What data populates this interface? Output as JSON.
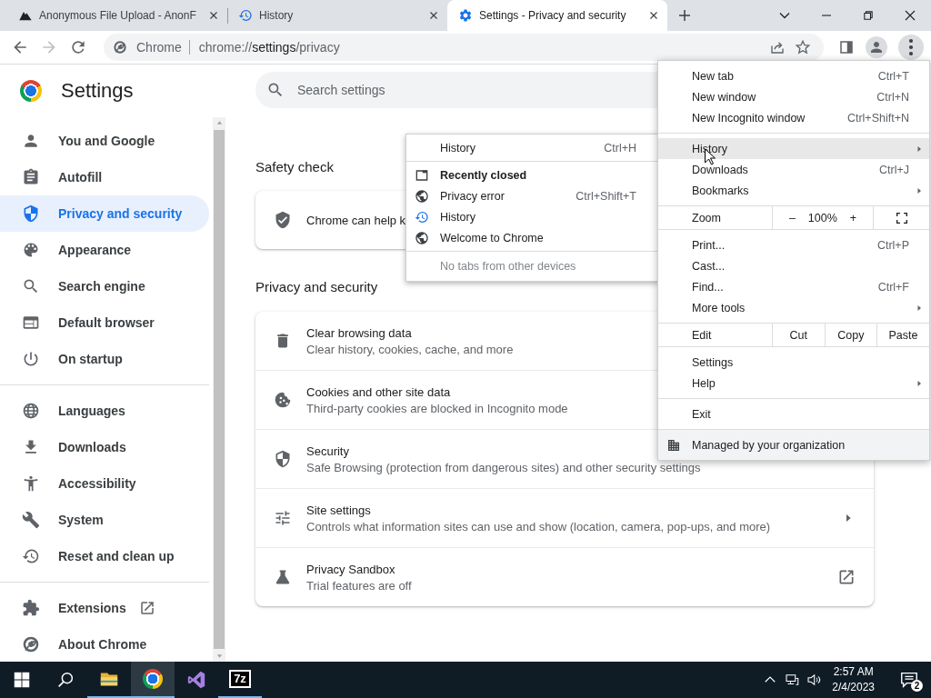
{
  "tabs": [
    {
      "title": "Anonymous File Upload - AnonF",
      "selected": false
    },
    {
      "title": "History",
      "selected": false
    },
    {
      "title": "Settings - Privacy and security",
      "selected": true
    }
  ],
  "toolbar": {
    "forward_disabled": true,
    "chip": "Chrome",
    "url": {
      "scheme": "chrome://",
      "host": "settings",
      "path": "/privacy"
    },
    "menu_open": true
  },
  "sidebar": {
    "title": "Settings",
    "groups": [
      [
        {
          "label": "You and Google",
          "selected": false,
          "external": false
        },
        {
          "label": "Autofill",
          "selected": false,
          "external": false
        },
        {
          "label": "Privacy and security",
          "selected": true,
          "external": false
        },
        {
          "label": "Appearance",
          "selected": false,
          "external": false
        },
        {
          "label": "Search engine",
          "selected": false,
          "external": false
        },
        {
          "label": "Default browser",
          "selected": false,
          "external": false
        },
        {
          "label": "On startup",
          "selected": false,
          "external": false
        }
      ],
      [
        {
          "label": "Languages",
          "selected": false,
          "external": false
        },
        {
          "label": "Downloads",
          "selected": false,
          "external": false
        },
        {
          "label": "Accessibility",
          "selected": false,
          "external": false
        },
        {
          "label": "System",
          "selected": false,
          "external": false
        },
        {
          "label": "Reset and clean up",
          "selected": false,
          "external": false
        }
      ],
      [
        {
          "label": "Extensions",
          "selected": false,
          "external": true
        },
        {
          "label": "About Chrome",
          "selected": false,
          "external": false
        }
      ]
    ]
  },
  "search": {
    "placeholder": "Search settings"
  },
  "sections": [
    {
      "title": "Safety check",
      "rows": [
        {
          "title": "Chrome can help k"
        }
      ]
    },
    {
      "title": "Privacy and security",
      "rows": [
        {
          "title": "Clear browsing data",
          "subtitle": "Clear history, cookies, cache, and more"
        },
        {
          "title": "Cookies and other site data",
          "subtitle": "Third-party cookies are blocked in Incognito mode"
        },
        {
          "title": "Security",
          "subtitle": "Safe Browsing (protection from dangerous sites) and other security settings"
        },
        {
          "title": "Site settings",
          "subtitle": "Controls what information sites can use and show (location, camera, pop-ups, and more)",
          "arrow": true
        },
        {
          "title": "Privacy Sandbox",
          "subtitle": "Trial features are off",
          "external": true
        }
      ]
    }
  ],
  "menu": {
    "groups": [
      [
        {
          "kind": "item",
          "label": "New tab",
          "shortcut": "Ctrl+T",
          "submenu": false,
          "highlighted": false
        },
        {
          "kind": "item",
          "label": "New window",
          "shortcut": "Ctrl+N",
          "submenu": false,
          "highlighted": false
        },
        {
          "kind": "item",
          "label": "New Incognito window",
          "shortcut": "Ctrl+Shift+N",
          "submenu": false,
          "highlighted": false
        }
      ],
      [
        {
          "kind": "item",
          "label": "History",
          "submenu": true,
          "highlighted": true
        },
        {
          "kind": "item",
          "label": "Downloads",
          "shortcut": "Ctrl+J",
          "submenu": false,
          "highlighted": false
        },
        {
          "kind": "item",
          "label": "Bookmarks",
          "submenu": true,
          "highlighted": false
        }
      ],
      [
        {
          "kind": "zoom",
          "label": "Zoom",
          "minus": "–",
          "value": "100%",
          "plus": "+"
        }
      ],
      [
        {
          "kind": "item",
          "label": "Print...",
          "shortcut": "Ctrl+P",
          "submenu": false,
          "highlighted": false
        },
        {
          "kind": "item",
          "label": "Cast...",
          "submenu": false,
          "highlighted": false
        },
        {
          "kind": "item",
          "label": "Find...",
          "shortcut": "Ctrl+F",
          "submenu": false,
          "highlighted": false
        },
        {
          "kind": "item",
          "label": "More tools",
          "submenu": true,
          "highlighted": false
        }
      ],
      [
        {
          "kind": "edit",
          "label": "Edit",
          "actions": [
            "Cut",
            "Copy",
            "Paste"
          ]
        }
      ],
      [
        {
          "kind": "item",
          "label": "Settings",
          "submenu": false,
          "highlighted": false
        },
        {
          "kind": "item",
          "label": "Help",
          "submenu": true,
          "highlighted": false
        }
      ],
      [
        {
          "kind": "item",
          "label": "Exit",
          "submenu": false,
          "highlighted": false
        }
      ],
      [
        {
          "kind": "managed",
          "label": "Managed by your organization"
        }
      ]
    ]
  },
  "submenu": {
    "groups": [
      [
        {
          "kind": "item",
          "label": "History",
          "shortcut": "Ctrl+H"
        }
      ],
      [
        {
          "kind": "header",
          "label": "Recently closed"
        },
        {
          "kind": "entry",
          "label": "Privacy error",
          "shortcut": "Ctrl+Shift+T"
        },
        {
          "kind": "entry",
          "label": "History"
        },
        {
          "kind": "entry",
          "label": "Welcome to Chrome"
        }
      ],
      [
        {
          "kind": "note",
          "label": "No tabs from other devices"
        }
      ]
    ]
  },
  "taskbar": {
    "apps": [
      {
        "running": true,
        "active": false
      },
      {
        "running": true,
        "active": true
      },
      {
        "running": false,
        "active": false
      },
      {
        "running": true,
        "active": false,
        "label": "7z"
      }
    ],
    "time": "2:57 AM",
    "date": "2/4/2023",
    "notifications": "2"
  }
}
